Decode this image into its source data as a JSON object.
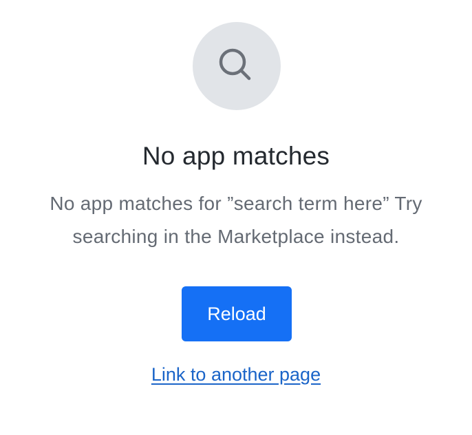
{
  "empty_state": {
    "icon": "search-icon",
    "title": "No app matches",
    "description": "No app matches for ”search term here” Try searching in the Marketplace instead.",
    "primary_button_label": "Reload",
    "link_label": "Link to another page"
  },
  "colors": {
    "icon_background": "#e1e4e8",
    "icon_stroke": "#6b7078",
    "title": "#24292f",
    "description": "#646a73",
    "button_background": "#1570f5",
    "button_text": "#ffffff",
    "link": "#1a64c8"
  }
}
